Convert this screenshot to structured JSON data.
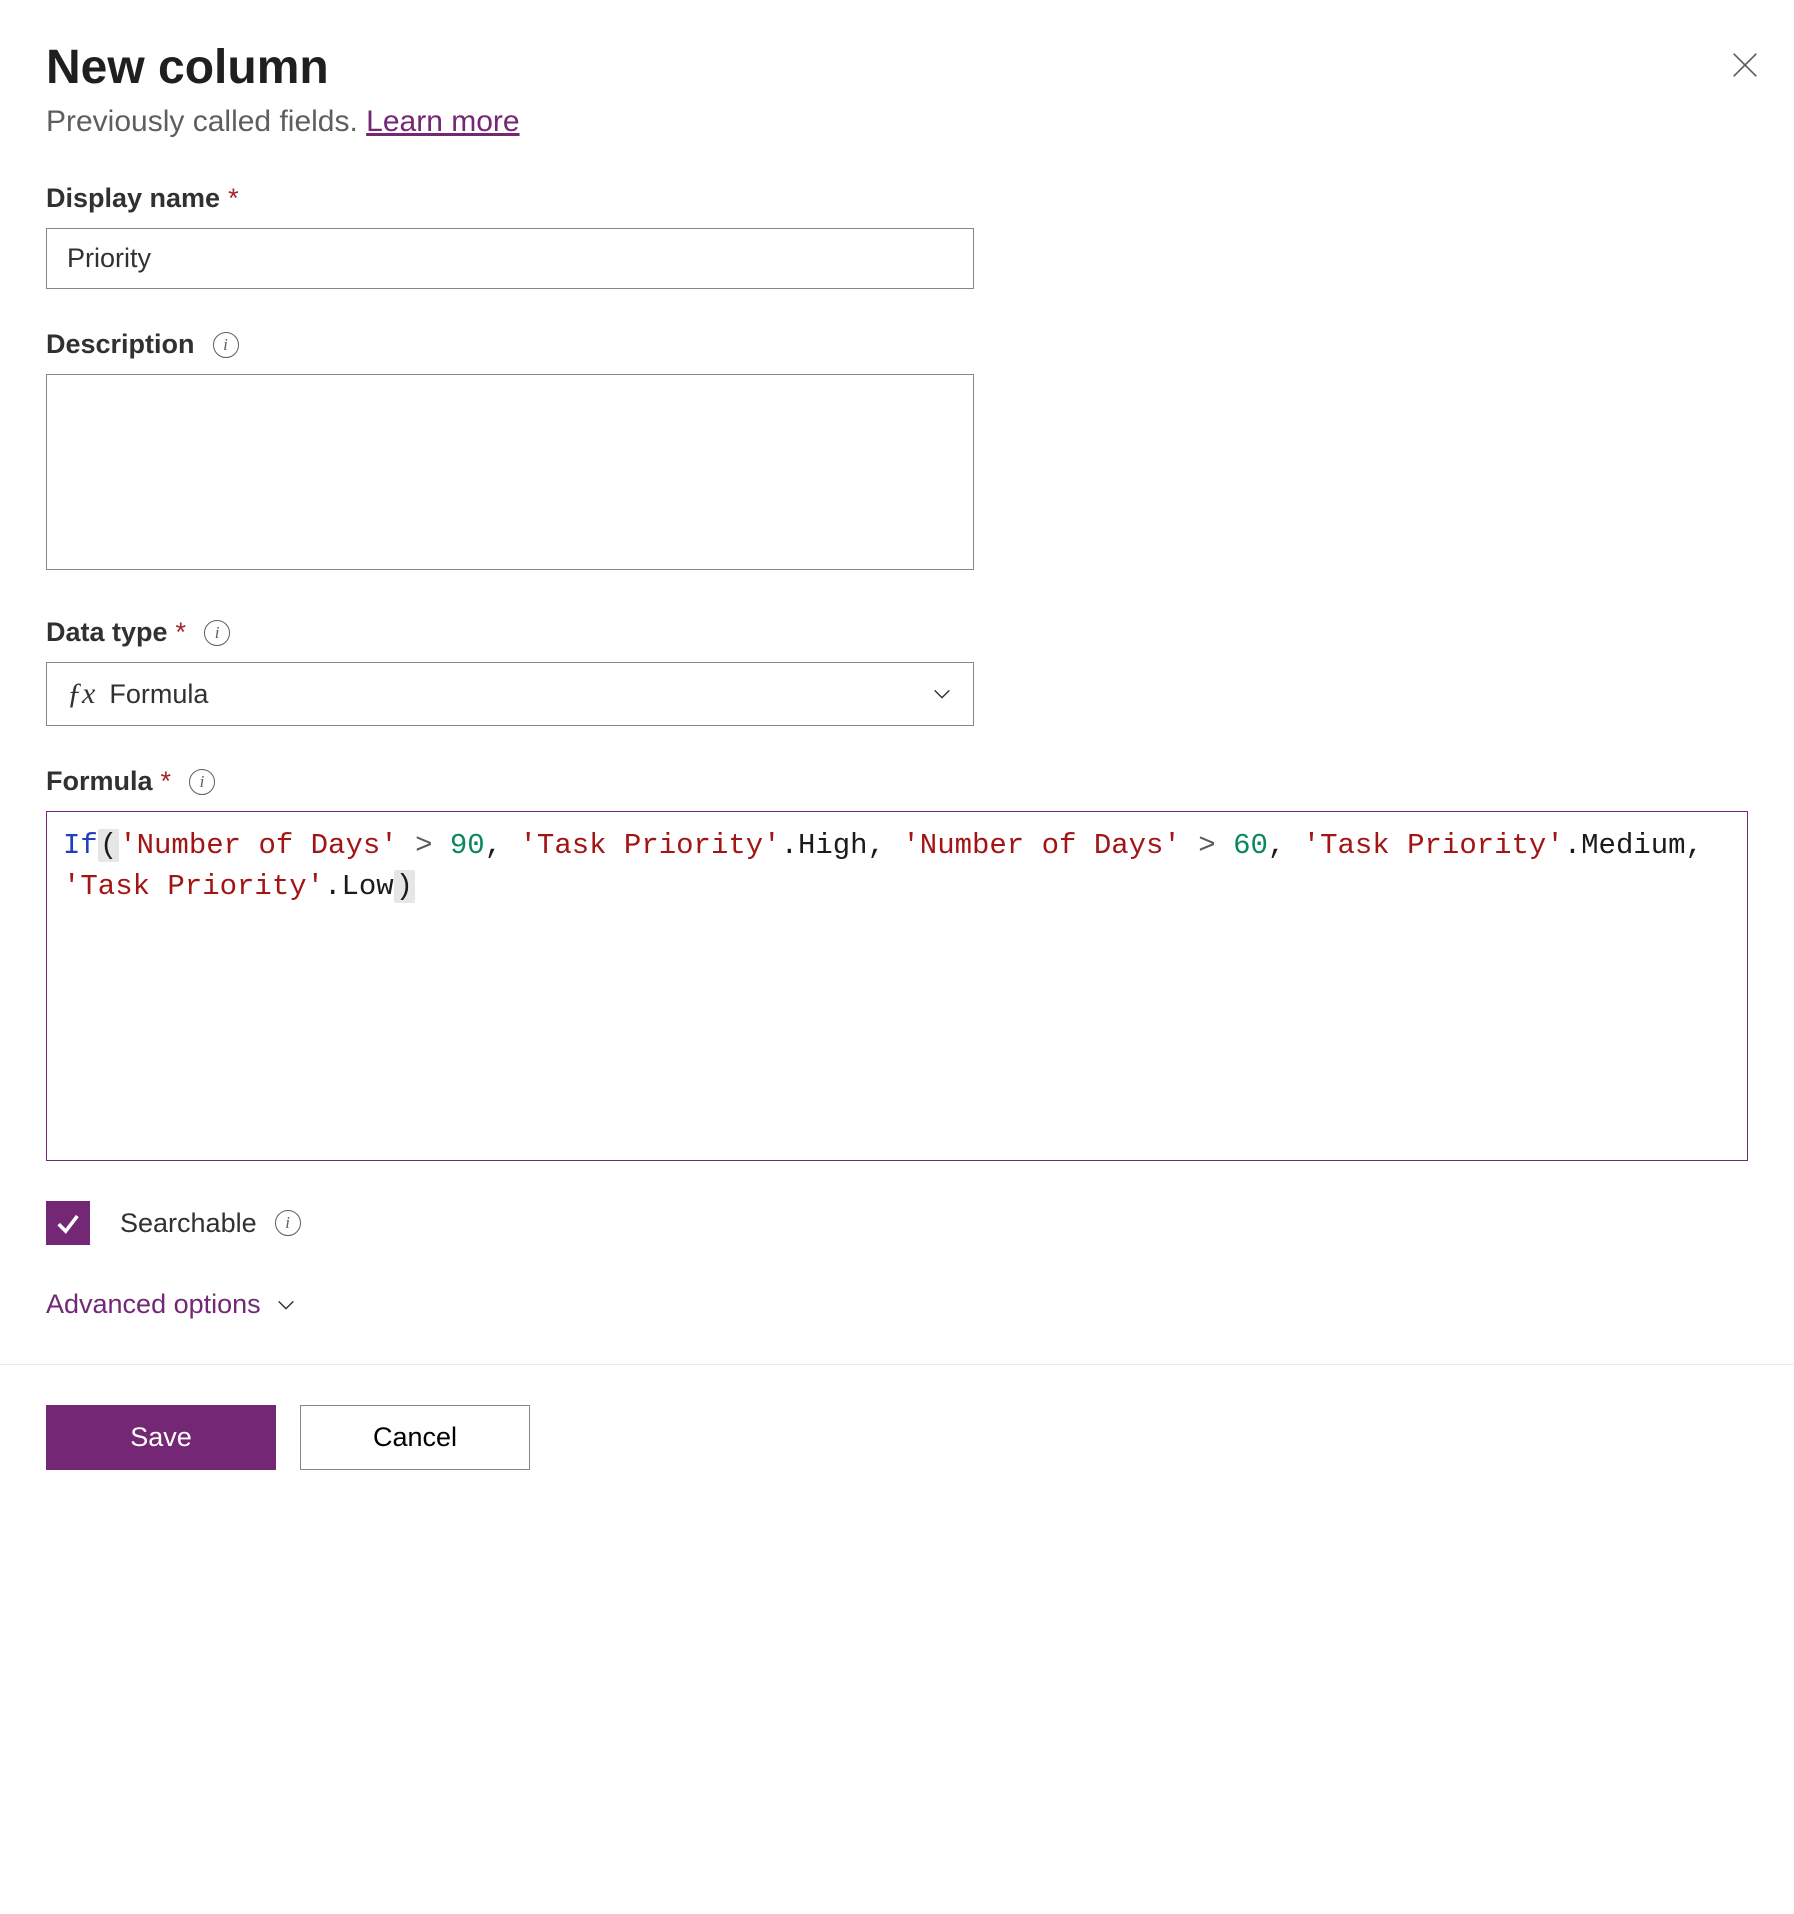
{
  "header": {
    "title": "New column",
    "subtitle_text": "Previously called fields.",
    "learn_more": "Learn more"
  },
  "fields": {
    "display_name": {
      "label": "Display name",
      "value": "Priority",
      "required": true
    },
    "description": {
      "label": "Description",
      "value": "",
      "has_info": true
    },
    "data_type": {
      "label": "Data type",
      "value": "Formula",
      "required": true,
      "has_info": true
    },
    "formula": {
      "label": "Formula",
      "required": true,
      "has_info": true,
      "tokens": [
        {
          "t": "fn",
          "v": "If"
        },
        {
          "t": "paren-hl",
          "v": "("
        },
        {
          "t": "str",
          "v": "'Number of Days'"
        },
        {
          "t": "plain",
          "v": " "
        },
        {
          "t": "op",
          "v": ">"
        },
        {
          "t": "plain",
          "v": " "
        },
        {
          "t": "num",
          "v": "90"
        },
        {
          "t": "plain",
          "v": ", "
        },
        {
          "t": "str",
          "v": "'Task Priority'"
        },
        {
          "t": "plain",
          "v": ".High, "
        },
        {
          "t": "str",
          "v": "'Number of Days'"
        },
        {
          "t": "plain",
          "v": " "
        },
        {
          "t": "op",
          "v": ">"
        },
        {
          "t": "plain",
          "v": " "
        },
        {
          "t": "num",
          "v": "60"
        },
        {
          "t": "plain",
          "v": ", "
        },
        {
          "t": "str",
          "v": "'Task Priority'"
        },
        {
          "t": "plain",
          "v": ".Medium, "
        },
        {
          "t": "str",
          "v": "'Task Priority'"
        },
        {
          "t": "plain",
          "v": ".Low"
        },
        {
          "t": "paren-hl",
          "v": ")"
        }
      ],
      "raw": "If('Number of Days' > 90, 'Task Priority'.High, 'Number of Days' > 60, 'Task Priority'.Medium, 'Task Priority'.Low)"
    }
  },
  "searchable": {
    "label": "Searchable",
    "checked": true
  },
  "advanced_options": "Advanced options",
  "buttons": {
    "save": "Save",
    "cancel": "Cancel"
  }
}
